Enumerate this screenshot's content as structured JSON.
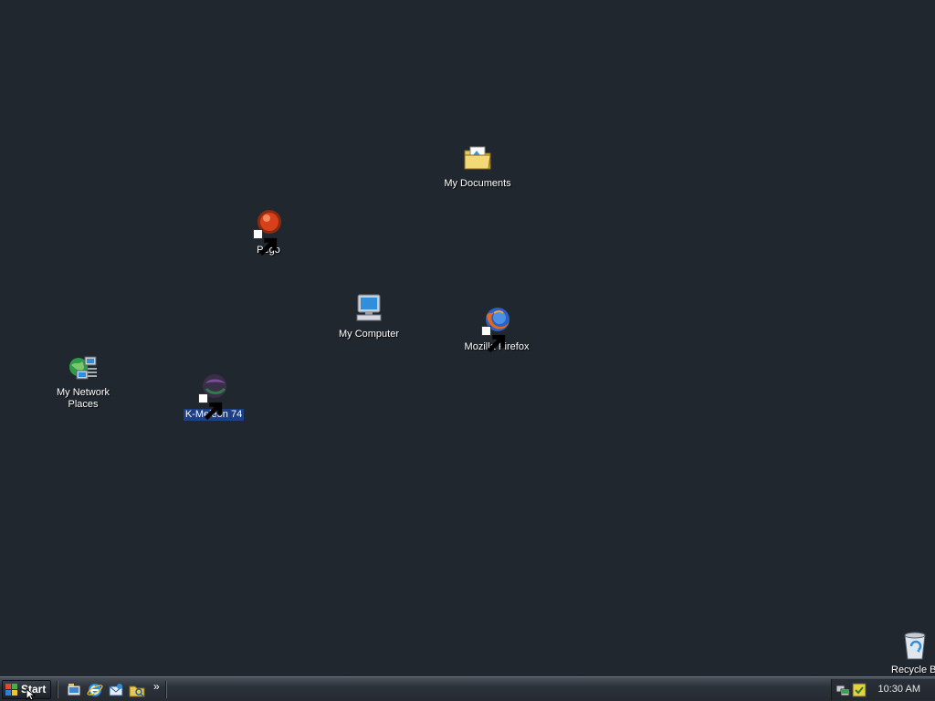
{
  "desktop": {
    "icons": {
      "my_documents": "My Documents",
      "pego": "Pego",
      "my_computer": "My Computer",
      "mozilla_firefox": "Mozilla Firefox",
      "my_network_places_line1": "My Network",
      "my_network_places_line2": "Places",
      "kmeleon": "K-Meleon 74",
      "recycle_bin": "Recycle Bin"
    },
    "selected_icon": "K-Meleon 74"
  },
  "taskbar": {
    "start_label": "Start",
    "quick_launch": [
      "show-desktop-icon",
      "internet-explorer-icon",
      "outlook-express-icon",
      "windows-explorer-icon"
    ],
    "overflow": "»",
    "tray_icons": [
      "network-icon",
      "security-icon"
    ],
    "clock": "10:30 AM"
  },
  "colors": {
    "desktop_background": "#21272f",
    "selection": "#1d3f86"
  }
}
